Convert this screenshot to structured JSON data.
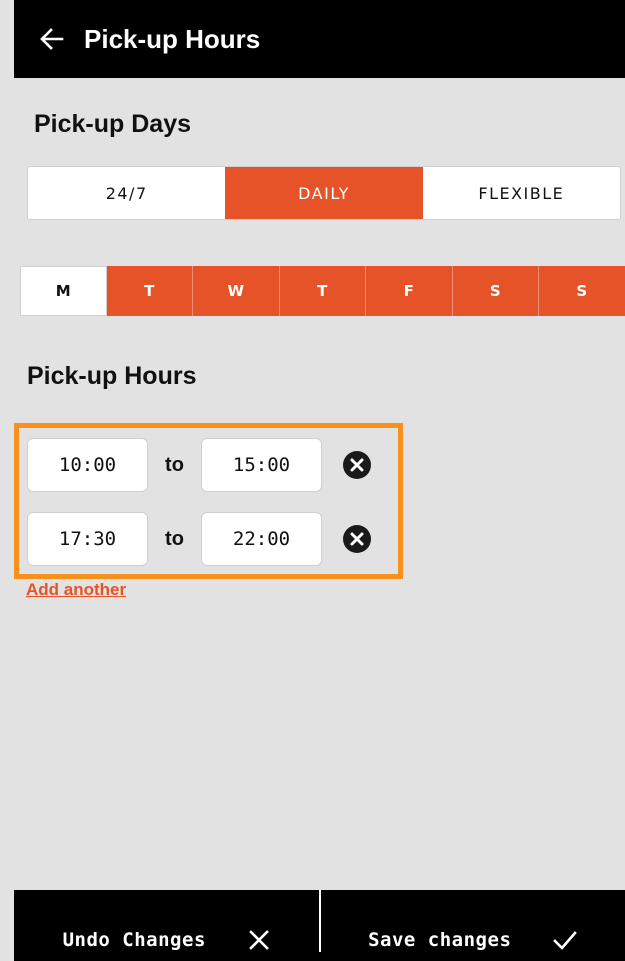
{
  "header": {
    "title": "Pick-up Hours",
    "back_icon": "arrow-left-icon"
  },
  "days_section": {
    "title": "Pick-up Days",
    "modes": [
      {
        "label": "24/7",
        "active": false
      },
      {
        "label": "DAILY",
        "active": true
      },
      {
        "label": "FLEXIBLE",
        "active": false
      }
    ],
    "days": [
      {
        "label": "M",
        "selected": false
      },
      {
        "label": "T",
        "selected": true
      },
      {
        "label": "W",
        "selected": true
      },
      {
        "label": "T",
        "selected": true
      },
      {
        "label": "F",
        "selected": true
      },
      {
        "label": "S",
        "selected": true
      },
      {
        "label": "S",
        "selected": true
      }
    ]
  },
  "hours_section": {
    "title": "Pick-up Hours",
    "separator": "to",
    "slots": [
      {
        "from": "10:00",
        "to": "15:00"
      },
      {
        "from": "17:30",
        "to": "22:00"
      }
    ],
    "add_link": "Add another"
  },
  "bottom_bar": {
    "undo_label": "Undo Changes",
    "save_label": "Save changes"
  },
  "colors": {
    "accent": "#e65328",
    "highlight_border": "#f8901e",
    "background": "#e2e2e2",
    "bar": "#000000"
  }
}
